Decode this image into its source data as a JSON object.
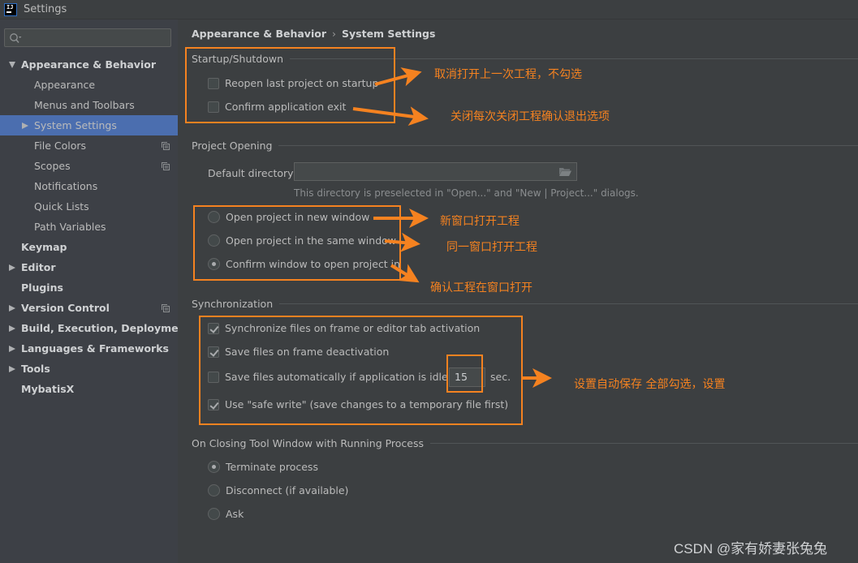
{
  "window": {
    "title": "Settings",
    "logo": "IJ"
  },
  "sidebar": {
    "search_placeholder": "",
    "items": [
      {
        "label": "Appearance & Behavior",
        "level": 0,
        "expanded": true
      },
      {
        "label": "Appearance",
        "level": 1
      },
      {
        "label": "Menus and Toolbars",
        "level": 1
      },
      {
        "label": "System Settings",
        "level": 1,
        "selected": true,
        "collapsed": true
      },
      {
        "label": "File Colors",
        "level": 1,
        "project_icon": true
      },
      {
        "label": "Scopes",
        "level": 1,
        "project_icon": true
      },
      {
        "label": "Notifications",
        "level": 1
      },
      {
        "label": "Quick Lists",
        "level": 1
      },
      {
        "label": "Path Variables",
        "level": 1
      },
      {
        "label": "Keymap",
        "level": 0
      },
      {
        "label": "Editor",
        "level": 0,
        "collapsed": true
      },
      {
        "label": "Plugins",
        "level": 0
      },
      {
        "label": "Version Control",
        "level": 0,
        "collapsed": true,
        "project_icon": true
      },
      {
        "label": "Build, Execution, Deployment",
        "level": 0,
        "collapsed": true
      },
      {
        "label": "Languages & Frameworks",
        "level": 0,
        "collapsed": true
      },
      {
        "label": "Tools",
        "level": 0,
        "collapsed": true
      },
      {
        "label": "MybatisX",
        "level": 0
      }
    ]
  },
  "breadcrumb": {
    "parent": "Appearance & Behavior",
    "separator": "›",
    "current": "System Settings"
  },
  "startup": {
    "title": "Startup/Shutdown",
    "reopen_last_project": {
      "label": "Reopen last project on startup",
      "checked": false
    },
    "confirm_exit": {
      "label": "Confirm application exit",
      "checked": false
    }
  },
  "project_opening": {
    "title": "Project Opening",
    "default_directory_label": "Default directory:",
    "default_directory_value": "",
    "hint": "This directory is preselected in \"Open...\" and \"New | Project...\" dialogs.",
    "options": [
      {
        "label": "Open project in new window",
        "checked": false
      },
      {
        "label": "Open project in the same window",
        "checked": false
      },
      {
        "label": "Confirm window to open project in",
        "checked": true
      }
    ]
  },
  "synchronization": {
    "title": "Synchronization",
    "sync_on_activation": {
      "label": "Synchronize files on frame or editor tab activation",
      "checked": true
    },
    "save_on_deactivation": {
      "label": "Save files on frame deactivation",
      "checked": true
    },
    "save_idle": {
      "label": "Save files automatically if application is idle for",
      "checked": false,
      "value": "15",
      "unit": "sec."
    },
    "safe_write": {
      "label": "Use \"safe write\" (save changes to a temporary file first)",
      "checked": true
    }
  },
  "closing": {
    "title": "On Closing Tool Window with Running Process",
    "options": [
      {
        "label": "Terminate process",
        "checked": true
      },
      {
        "label": "Disconnect (if available)",
        "checked": false
      },
      {
        "label": "Ask",
        "checked": false
      }
    ]
  },
  "annotations": {
    "color": "#f58220",
    "notes": [
      "取消打开上一次工程，不勾选",
      "关闭每次关闭工程确认退出选项",
      "新窗口打开工程",
      "同一窗口打开工程",
      "确认工程在窗口打开",
      "设置自动保存 全部勾选，设置"
    ]
  },
  "watermark": "CSDN @家有娇妻张兔兔",
  "colors": {
    "selection": "#4b6eaf",
    "background": "#3c3f41",
    "sidebar": "#3d4046",
    "annotation": "#f58220"
  }
}
